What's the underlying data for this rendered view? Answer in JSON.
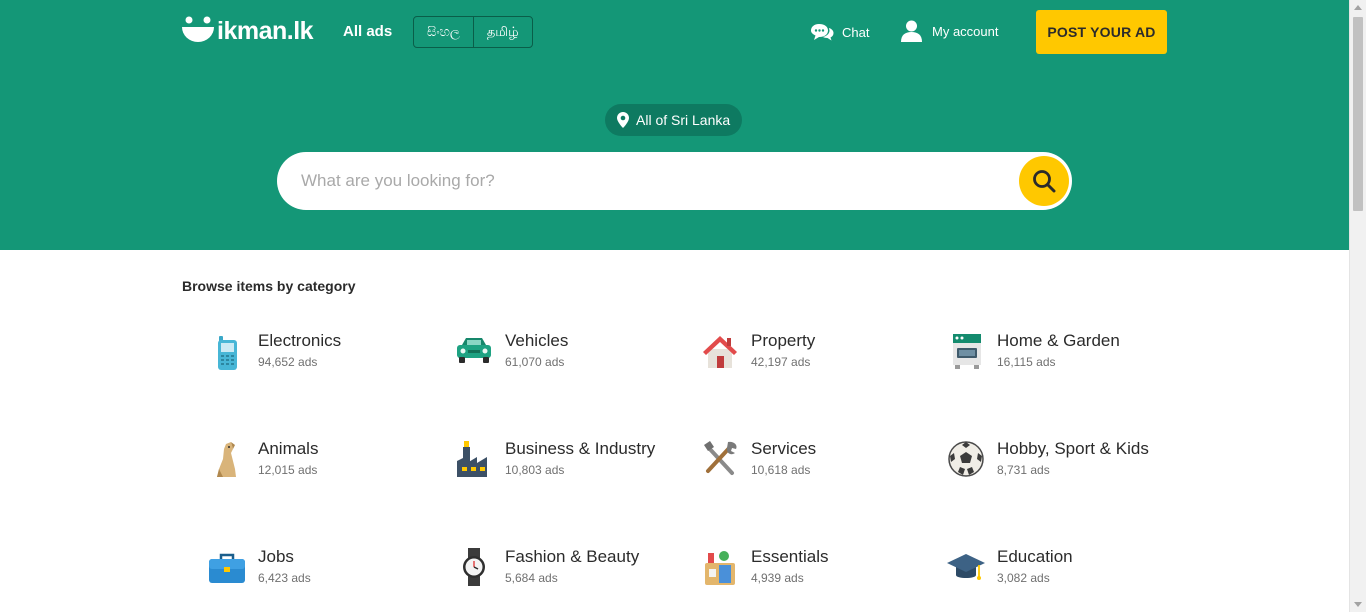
{
  "header": {
    "logo_text": "ikman.lk",
    "all_ads_label": "All ads",
    "languages": [
      "සිංහල",
      "தமிழ்"
    ],
    "chat_label": "Chat",
    "account_label": "My account",
    "post_ad_label": "POST YOUR AD",
    "brand_color": "#149777",
    "accent_color": "#ffc800"
  },
  "search": {
    "location_label": "All of Sri Lanka",
    "placeholder": "What are you looking for?",
    "value": ""
  },
  "browse": {
    "title": "Browse items by category",
    "categories": [
      {
        "name": "Electronics",
        "count": "94,652 ads",
        "icon": "mobile-phone-icon"
      },
      {
        "name": "Vehicles",
        "count": "61,070 ads",
        "icon": "car-icon"
      },
      {
        "name": "Property",
        "count": "42,197 ads",
        "icon": "house-icon"
      },
      {
        "name": "Home & Garden",
        "count": "16,115 ads",
        "icon": "stove-icon"
      },
      {
        "name": "Animals",
        "count": "12,015 ads",
        "icon": "dog-icon"
      },
      {
        "name": "Business & Industry",
        "count": "10,803 ads",
        "icon": "factory-icon"
      },
      {
        "name": "Services",
        "count": "10,618 ads",
        "icon": "tools-icon"
      },
      {
        "name": "Hobby, Sport & Kids",
        "count": "8,731 ads",
        "icon": "soccer-ball-icon"
      },
      {
        "name": "Jobs",
        "count": "6,423 ads",
        "icon": "briefcase-icon"
      },
      {
        "name": "Fashion & Beauty",
        "count": "5,684 ads",
        "icon": "wristwatch-icon"
      },
      {
        "name": "Essentials",
        "count": "4,939 ads",
        "icon": "grocery-bag-icon"
      },
      {
        "name": "Education",
        "count": "3,082 ads",
        "icon": "graduation-cap-icon"
      }
    ]
  }
}
